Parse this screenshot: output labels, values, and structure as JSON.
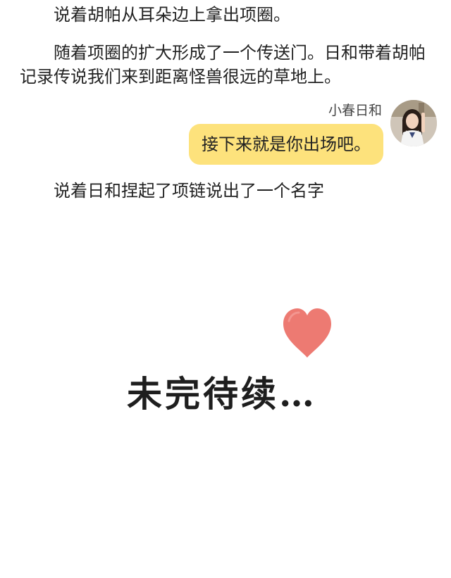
{
  "story": {
    "paragraph_1": "说着胡帕从耳朵边上拿出项圈。",
    "paragraph_2": "随着项圈的扩大形成了一个传送门。日和带着胡帕记录传说我们来到距离怪兽很远的草地上。",
    "paragraph_3": "说着日和捏起了项链说出了一个名字"
  },
  "chat": {
    "speaker_name": "小春日和",
    "message": "接下来就是你出场吧。",
    "bubble_color": "#fde27c"
  },
  "ending": {
    "text": "未完待续…",
    "heart_color": "#ec6f66"
  }
}
